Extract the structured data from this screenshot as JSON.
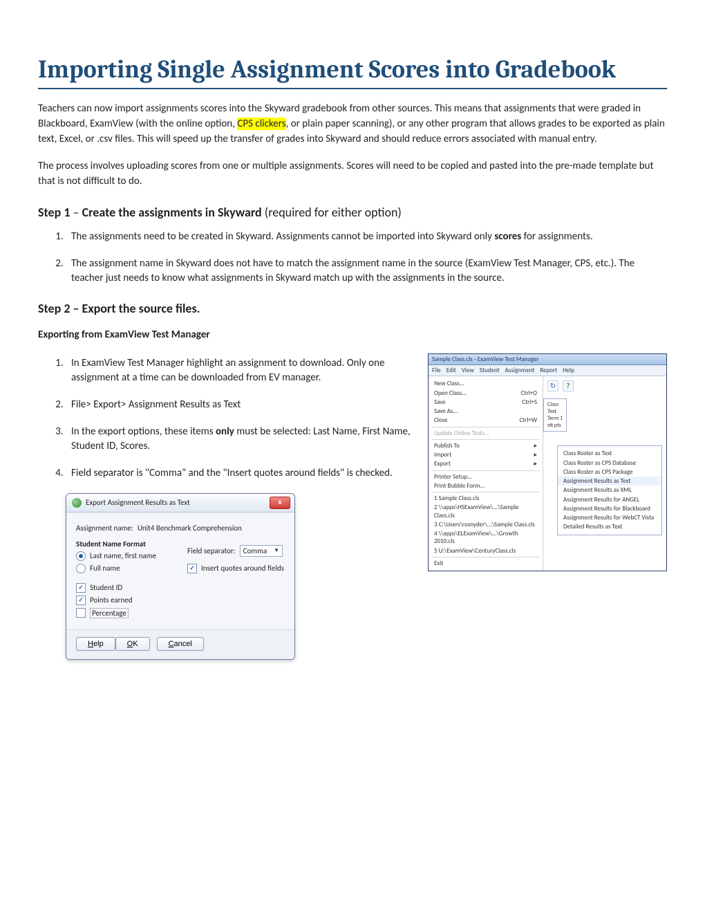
{
  "title": "Importing Single Assignment Scores into Gradebook",
  "intro": {
    "p1_a": "Teachers can now import assignments scores into the Skyward gradebook from other sources.  This means that assignments that were graded in Blackboard, ExamView (with the online option, ",
    "p1_hi": "CPS clickers",
    "p1_b": ", or plain paper scanning), or any other program that allows grades to be exported as plain text, Excel, or .csv files.  This will speed up the transfer of grades into Skyward and should reduce errors associated with manual entry.",
    "p2": "The process involves uploading scores from one or multiple assignments. Scores will need to be copied and pasted into the pre-made template but that is not difficult to do."
  },
  "step1": {
    "head_a": "Step 1",
    "head_sep": " – ",
    "head_b": "Create the assignments in Skyward",
    "head_c": " (required for either option)",
    "li1_a": "The assignments need to be created in Skyward.  Assignments cannot be imported into Skyward only ",
    "li1_b": "scores",
    "li1_c": " for assignments.",
    "li2": "The assignment name in Skyward does not have to match the assignment name in the source (ExamView Test Manager, CPS, etc.).  The teacher just needs to know what assignments in Skyward match up with the assignments in the source."
  },
  "step2": {
    "head": "Step 2 – Export the source files.",
    "sub": "Exporting from ExamView Test Manager",
    "li1": "In ExamView Test Manager highlight an assignment to download. Only one assignment at a time can be downloaded from EV manager.",
    "li2": "File> Export> Assignment Results as Text",
    "li3_a": "In the export options, these items ",
    "li3_b": "only",
    "li3_c": " must be selected: Last Name, First Name, Student ID, Scores.",
    "li4": "Field separator is \"Comma\" and the \"Insert quotes around fields\" is checked."
  },
  "sshot1": {
    "titlebar": "Sample Class.cls - ExamView Test Manager",
    "menubar": [
      "File",
      "Edit",
      "View",
      "Student",
      "Assignment",
      "Report",
      "Help"
    ],
    "menu": {
      "new": "New Class...",
      "open": "Open Class...",
      "open_sc": "Ctrl+O",
      "save": "Save",
      "save_sc": "Ctrl+S",
      "saveas": "Save As...",
      "close": "Close",
      "close_sc": "Ctrl+W",
      "update": "Update Online Tests...",
      "publish": "Publish To",
      "import": "Import",
      "export": "Export",
      "printer": "Printer Setup...",
      "bubble": "Print Bubble Form...",
      "recent": [
        "1 Sample Class.cls",
        "2 \\\\apps\\HSExamView\\...\\Sample Class.cls",
        "3 C:\\Users\\rosnyder\\...\\Sample Class.cls",
        "4 \\\\apps\\ELExamView\\...\\Growth 2010.cls",
        "5 U:\\ExamView\\CenturyClass.cls"
      ],
      "exit": "Exit"
    },
    "side": [
      "Class",
      "Text",
      "Term 1",
      "stt pts"
    ],
    "submenu": [
      "Class Roster as Text",
      "Class Roster as CPS Database",
      "Class Roster as CPS Package",
      "Assignment Results as Text",
      "Assignment Results as XML",
      "Assignment Results for ANGEL",
      "Assignment Results for Blackboard",
      "Assignment Results for WebCT Vista",
      "Detailed Results as Text"
    ]
  },
  "dlg": {
    "title": "Export Assignment Results as Text",
    "assign_label": "Assignment name:",
    "assign_value": "Unit4 Benchmark Comprehension",
    "snf": "Student Name Format",
    "opt_lastfirst": "Last name, first name",
    "opt_full": "Full name",
    "fsep_label": "Field separator:",
    "fsep_value": "Comma",
    "chk_quotes": "Insert quotes around fields",
    "chk_sid": "Student ID",
    "chk_points": "Points earned",
    "chk_pct": "Percentage",
    "btn_help_u": "H",
    "btn_help": "elp",
    "btn_ok_u": "O",
    "btn_ok": "K",
    "btn_cancel_u": "C",
    "btn_cancel": "ancel"
  }
}
